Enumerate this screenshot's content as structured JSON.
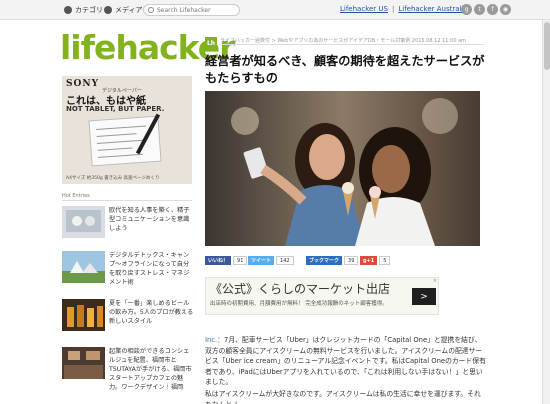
{
  "nav": {
    "category_label": "カテゴリ",
    "media_label": "メディア",
    "search_placeholder": "Search Lifehacker",
    "link_us": "Lifehacker US",
    "link_separator": "|",
    "link_au": "Lifehacker Australia",
    "social_icons": [
      "google-plus-icon",
      "twitter-icon",
      "facebook-icon",
      "rss-icon"
    ]
  },
  "logo": {
    "text": "lifehacker",
    "color": "#82b31c"
  },
  "sidebar_ad": {
    "brand": "SONY",
    "sub": "デジタルペーパー",
    "headline": "これは、もはや紙",
    "tagline": "NOT TABLET, BUT PAPER.",
    "caption": "A4サイズ 約350g 書き込み 高速ページめくり"
  },
  "sidebar": {
    "section_label": "Hot Entries",
    "items": [
      {
        "text": "欧代を知る人事を築く、精子型コミュニケーションを意識しよう"
      },
      {
        "text": "デジタルデトックス・キャンプ〜オフラインになって自分を取り戻すストレス・マネジメント術"
      },
      {
        "text": "夏を「一番」楽しめるビールの飲み方。5人のプロが教える新しいスタイル"
      },
      {
        "text": "起業の相談ができるコンシェルジュを配置、福岡市とTSUTAYAが手がける、福岡市スタートアップカフェの魅力。ワークデザイン｜福岡"
      }
    ]
  },
  "article": {
    "badge": "Lh",
    "meta": "ライフハッカー過数付 > WebやアプリのあのサービスがアイデアDB・モール対策例 2015.08.12 11:00 am",
    "title": "経営者が知るべき、顧客の期待を超えたサービスがもたらすもの",
    "share": [
      {
        "label": "いいね！",
        "count": "91",
        "color": "#3b5998"
      },
      {
        "label": "ツイート",
        "count": "142",
        "color": "#55acee"
      },
      {
        "label": "ブックマーク",
        "count": "39",
        "color": "#2c6ebd"
      },
      {
        "label": "g+1",
        "count": "5",
        "color": "#dd4b39"
      }
    ],
    "ad": {
      "headline": "《公式》くらしのマーケット出店",
      "sub": "出店時の初期費用、月額費用が無料！ 完全成功報酬のネット顧客獲得。",
      "button": ">",
      "close": "×"
    },
    "body_link": "Inc.",
    "body": "：7月、配車サービス「Uber」はクレジットカードの「Capital One」と提携を結び、双方の顧客全員にアイスクリームの無料サービスを行いました。アイスクリームの配達サービス「Uber ice cream」のリニューアル記念イベントです。私はCapital Oneのカード保有者であり、iPadにはUberアプリを入れているので、「これは利用しない手はない！」と思いました。",
    "body2": "私はアイスクリームが大好きなのです。アイスクリームは私の生活に幸せを運びます。それをなんと ！"
  }
}
